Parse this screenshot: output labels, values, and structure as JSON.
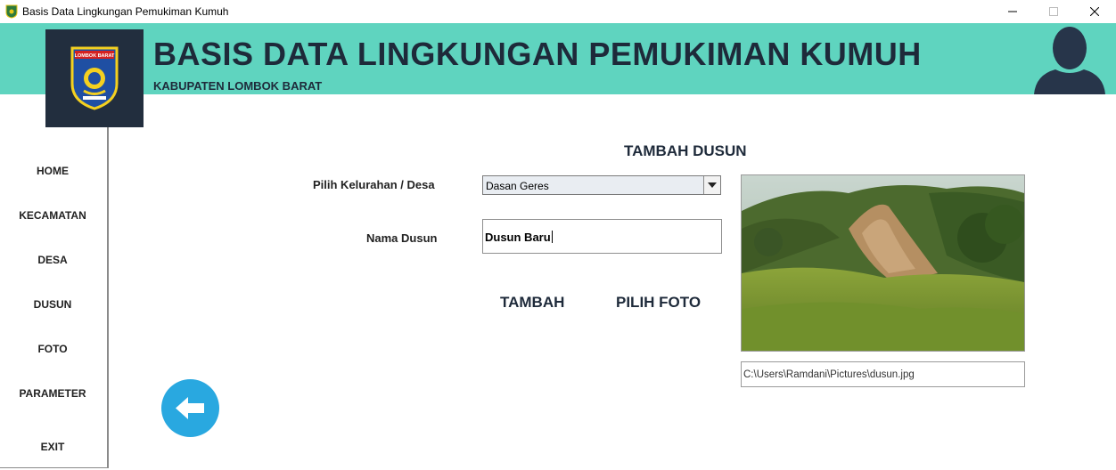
{
  "window": {
    "title": "Basis Data Lingkungan Pemukiman Kumuh"
  },
  "header": {
    "title": "BASIS DATA LINGKUNGAN PEMUKIMAN KUMUH",
    "subtitle": "KABUPATEN LOMBOK BARAT",
    "logo_text": "LOMBOK BARAT",
    "accent_color": "#5fd4bf",
    "dark_color": "#222e3e"
  },
  "sidebar": {
    "items": [
      {
        "label": "HOME"
      },
      {
        "label": "KECAMATAN"
      },
      {
        "label": "DESA"
      },
      {
        "label": "DUSUN"
      },
      {
        "label": "FOTO"
      },
      {
        "label": "PARAMETER"
      },
      {
        "label": "EXIT"
      }
    ]
  },
  "form": {
    "title": "TAMBAH DUSUN",
    "desa_label": "Pilih Kelurahan / Desa",
    "desa_value": "Dasan Geres",
    "dusun_label": "Nama Dusun",
    "dusun_value": "Dusun Baru",
    "add_button": "TAMBAH",
    "photo_button": "PILIH FOTO",
    "photo_path": "C:\\Users\\Ramdani\\Pictures\\dusun.jpg"
  },
  "icons": {
    "back": "arrow-left-icon",
    "avatar": "user-silhouette-icon",
    "dropdown": "chevron-down-icon",
    "back_button_color": "#29a8e0"
  }
}
